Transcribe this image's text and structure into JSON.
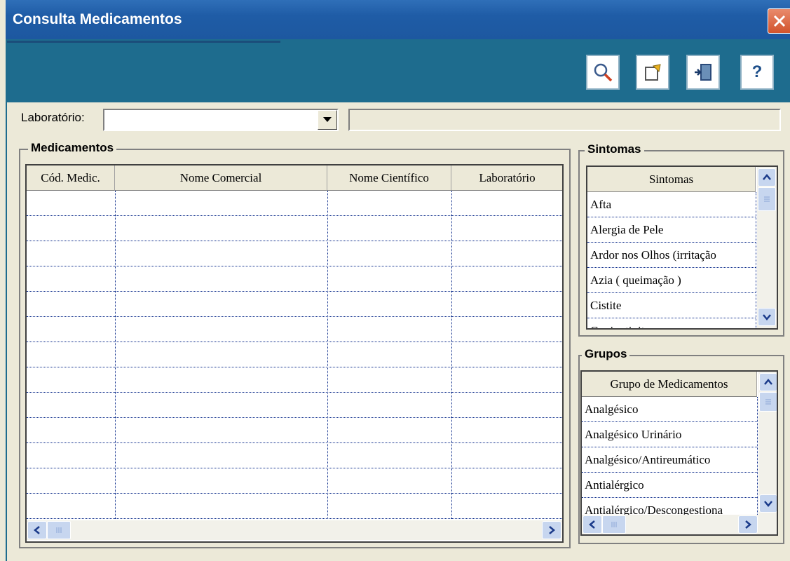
{
  "window": {
    "title": "Consulta Medicamentos"
  },
  "toolbar": {
    "buttons": [
      {
        "name": "search-button",
        "icon": "search-icon"
      },
      {
        "name": "edit-button",
        "icon": "edit-icon"
      },
      {
        "name": "exit-button",
        "icon": "exit-icon"
      },
      {
        "name": "help-button",
        "icon": "help-icon",
        "label": "?"
      }
    ]
  },
  "laboratorio": {
    "label": "Laboratório:",
    "value": "",
    "description": ""
  },
  "medicamentos": {
    "title": "Medicamentos",
    "columns": [
      "Cód. Medic.",
      "Nome Comercial",
      "Nome Científico",
      "Laboratório"
    ],
    "rows": []
  },
  "sintomas": {
    "title": "Sintomas",
    "column": "Sintomas",
    "items": [
      "Afta",
      "Alergia de Pele",
      "Ardor nos Olhos (irritação",
      "Azia ( queimação )",
      "Cistite",
      "Conjuntivite"
    ]
  },
  "grupos": {
    "title": "Grupos",
    "column": "Grupo de Medicamentos",
    "items": [
      "Analgésico",
      "Analgésico Urinário",
      "Analgésico/Antireumático",
      "Antialérgico",
      "Antialérgico/Descongestiona"
    ]
  },
  "colors": {
    "titlebar": "#1f5ca6",
    "toolbar": "#1e6c8e",
    "close": "#d2532d",
    "grid_lines": "#0a2a8a"
  }
}
